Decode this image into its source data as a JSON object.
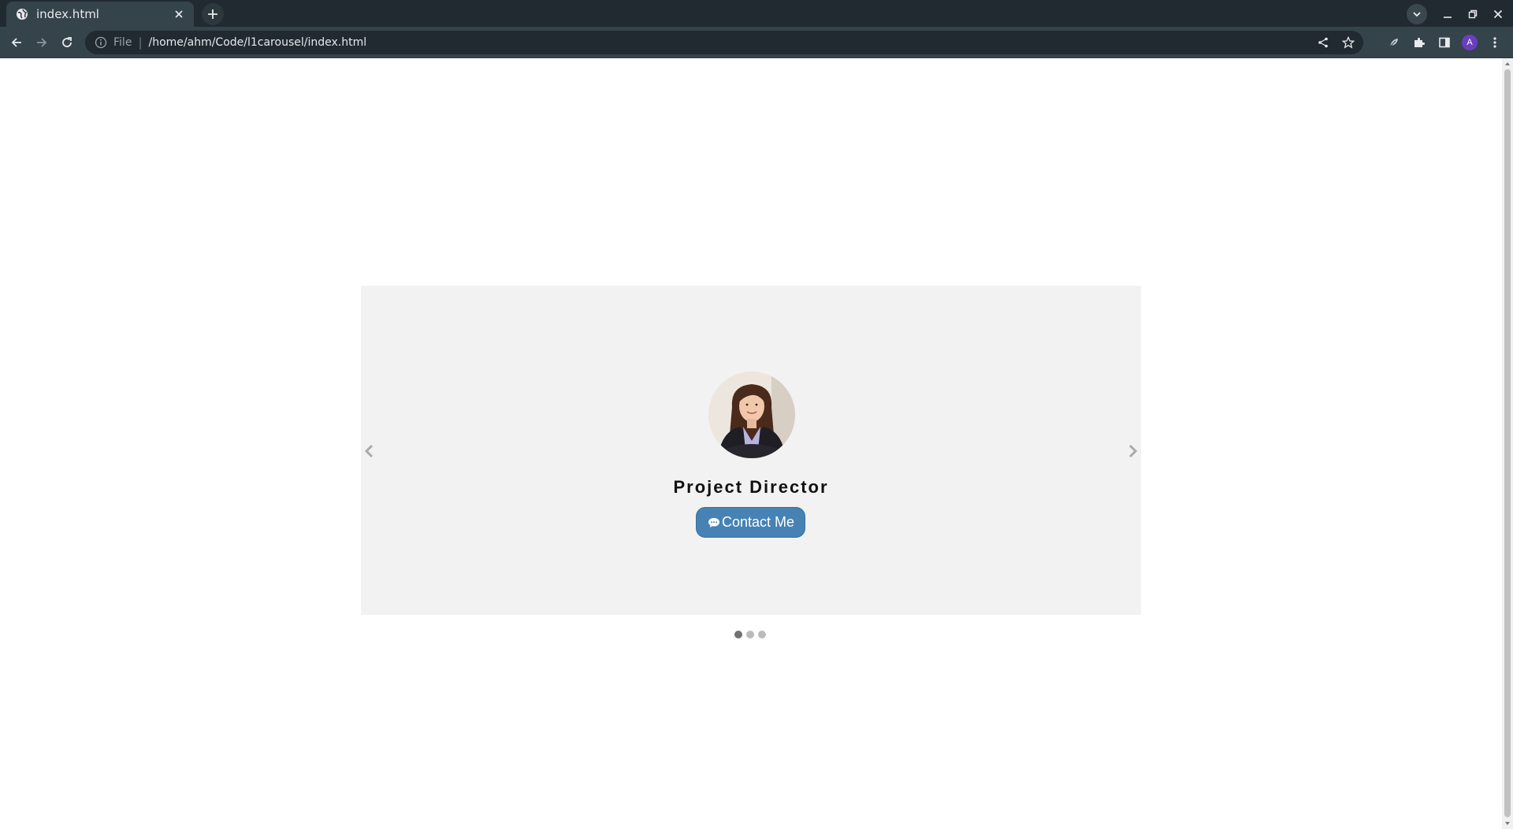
{
  "browser": {
    "tab_title": "index.html",
    "omnibox": {
      "scheme_label": "File",
      "url": "/home/ahm/Code/l1carousel/index.html"
    },
    "profile_initial": "A",
    "colors": {
      "frame": "#202a30",
      "toolbar": "#35434b",
      "avatar": "#6a3fbf"
    }
  },
  "carousel": {
    "slides": [
      {
        "role": "Project Director",
        "button_label": "Contact Me"
      }
    ],
    "indicators": 3,
    "active_index": 0,
    "colors": {
      "background": "#f2f2f2",
      "button": "#4682b4",
      "dot_active": "#717171",
      "dot_inactive": "#bbbbbb"
    }
  }
}
